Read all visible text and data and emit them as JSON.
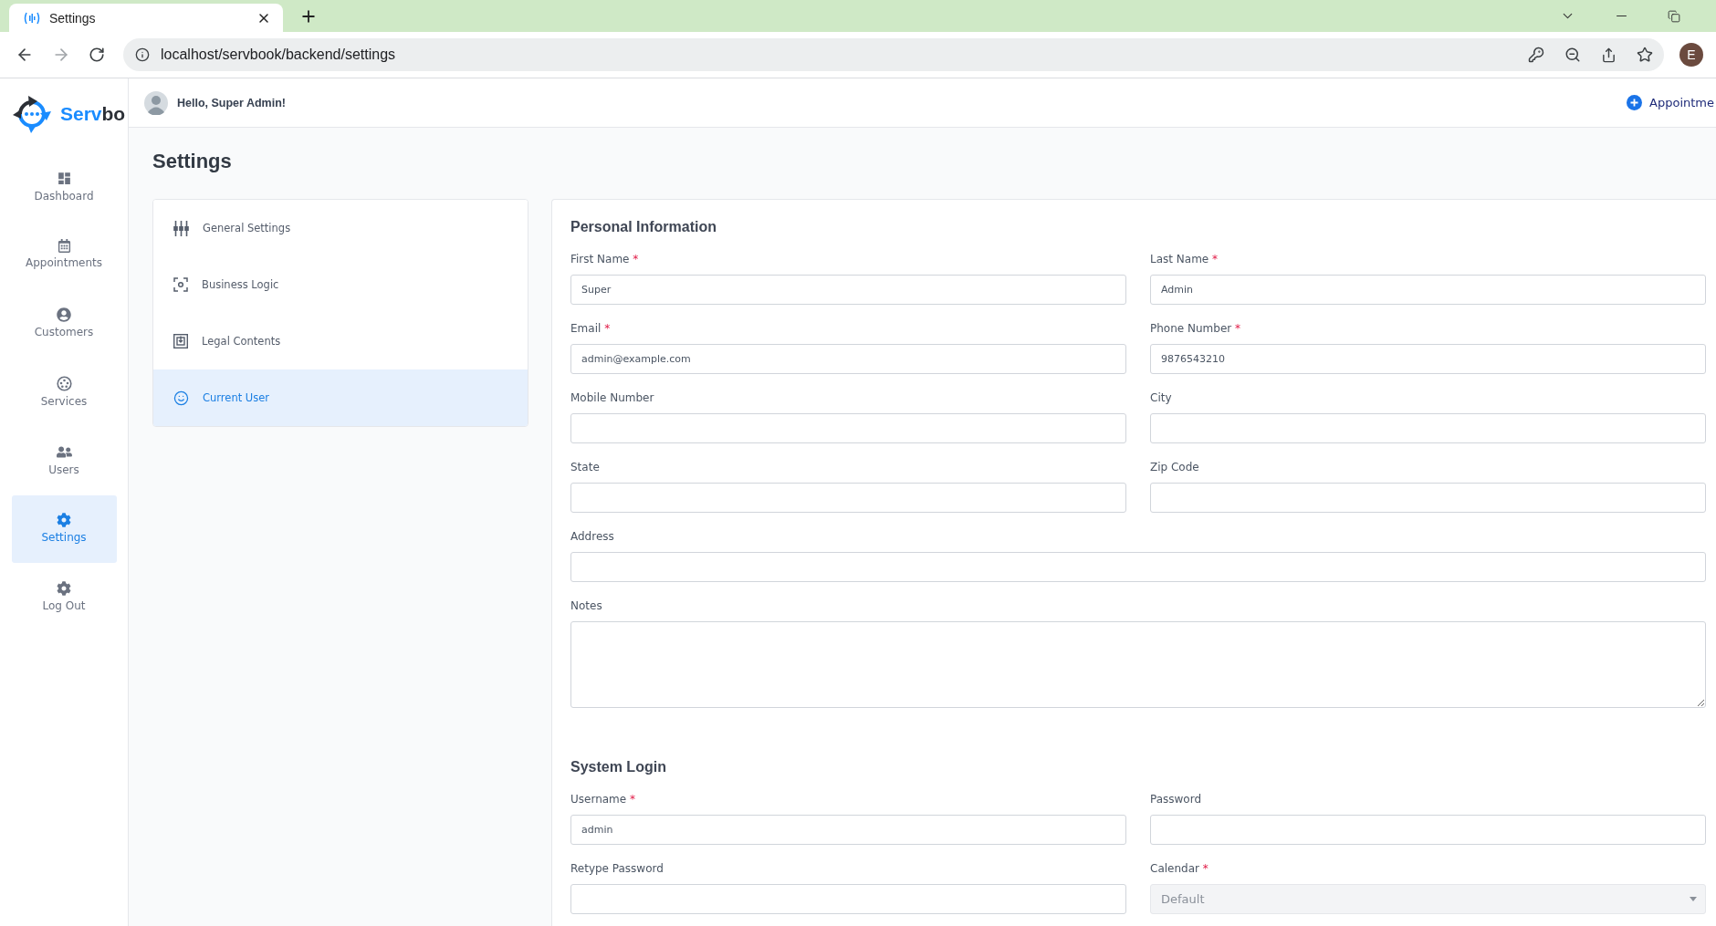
{
  "browser": {
    "tab_title": "Settings",
    "url": "localhost/servbook/backend/settings",
    "profile_initial": "E"
  },
  "logo": {
    "text_primary": "Serv",
    "text_secondary": "bo"
  },
  "sidebar": {
    "items": [
      {
        "label": "Dashboard",
        "selected": false
      },
      {
        "label": "Appointments",
        "selected": false
      },
      {
        "label": "Customers",
        "selected": false
      },
      {
        "label": "Services",
        "selected": false
      },
      {
        "label": "Users",
        "selected": false
      },
      {
        "label": "Settings",
        "selected": true
      },
      {
        "label": "Log Out",
        "selected": false
      }
    ]
  },
  "header": {
    "greeting": "Hello, Super Admin!",
    "action": "Appointme"
  },
  "page_title": "Settings",
  "settings_menu": {
    "items": [
      {
        "label": "General Settings",
        "selected": false
      },
      {
        "label": "Business Logic",
        "selected": false
      },
      {
        "label": "Legal Contents",
        "selected": false
      },
      {
        "label": "Current User",
        "selected": true
      }
    ]
  },
  "form": {
    "sections": [
      {
        "title": "Personal Information",
        "rows": [
          [
            {
              "kind": "text",
              "label": "First Name",
              "required_mark": "*",
              "value": "Super",
              "disabled": false
            },
            {
              "kind": "text",
              "label": "Last Name",
              "required_mark": "*",
              "value": "Admin",
              "disabled": false
            }
          ],
          [
            {
              "kind": "text",
              "label": "Email",
              "required_mark": "*",
              "value": "admin@example.com",
              "disabled": false
            },
            {
              "kind": "text",
              "label": "Phone Number",
              "required_mark": "*",
              "value": "9876543210",
              "disabled": false
            }
          ],
          [
            {
              "kind": "text",
              "label": "Mobile Number",
              "disabled": false
            },
            {
              "kind": "text",
              "label": "City",
              "disabled": false
            }
          ],
          [
            {
              "kind": "text",
              "label": "State",
              "disabled": false
            },
            {
              "kind": "text",
              "label": "Zip Code",
              "disabled": false
            }
          ],
          [
            {
              "kind": "text",
              "label": "Address",
              "disabled": false
            }
          ],
          [
            {
              "kind": "textarea",
              "label": "Notes",
              "disabled": false
            }
          ]
        ]
      },
      {
        "title": "System Login",
        "rows": [
          [
            {
              "kind": "text",
              "label": "Username",
              "required_mark": "*",
              "value": "admin",
              "disabled": false
            },
            {
              "kind": "text",
              "label": "Password",
              "disabled": false
            }
          ],
          [
            {
              "kind": "text",
              "label": "Retype Password",
              "disabled": false
            },
            {
              "kind": "select",
              "label": "Calendar",
              "required_mark": "*",
              "value": "Default",
              "disabled": true
            }
          ]
        ]
      }
    ]
  }
}
